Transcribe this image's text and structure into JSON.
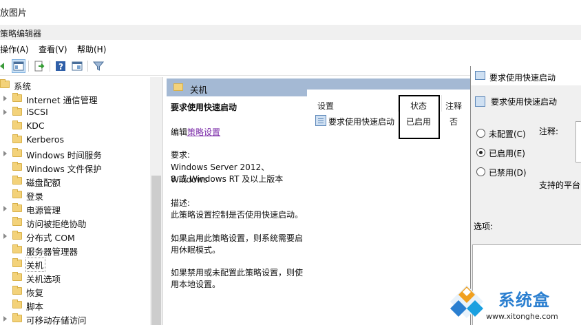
{
  "caption": "放图片",
  "window": {
    "title": "策略编辑器"
  },
  "menu": [
    {
      "label": "操作(A)"
    },
    {
      "label": "查看(V)"
    },
    {
      "label": "帮助(H)"
    }
  ],
  "toolbar": {
    "buttons": [
      "back-icon",
      "show-hide-tree-icon",
      "export-list-icon",
      "help-icon",
      "properties-view-icon",
      "filter-icon"
    ]
  },
  "tree": {
    "items": [
      {
        "label": "系统",
        "expandable": false
      },
      {
        "label": "Internet 通信管理",
        "expandable": true
      },
      {
        "label": "iSCSI",
        "expandable": true
      },
      {
        "label": "KDC",
        "expandable": false
      },
      {
        "label": "Kerberos",
        "expandable": false
      },
      {
        "label": "Windows 时间服务",
        "expandable": true
      },
      {
        "label": "Windows 文件保护",
        "expandable": false
      },
      {
        "label": "磁盘配额",
        "expandable": false
      },
      {
        "label": "登录",
        "expandable": false
      },
      {
        "label": "电源管理",
        "expandable": true
      },
      {
        "label": "访问被拒绝协助",
        "expandable": false
      },
      {
        "label": "分布式 COM",
        "expandable": true
      },
      {
        "label": "服务器管理器",
        "expandable": false
      },
      {
        "label": "关机",
        "expandable": false,
        "selected": true
      },
      {
        "label": "关机选项",
        "expandable": false
      },
      {
        "label": "恢复",
        "expandable": false
      },
      {
        "label": "脚本",
        "expandable": false
      },
      {
        "label": "可移动存储访问",
        "expandable": true
      }
    ]
  },
  "content": {
    "header_title": "关机",
    "description": {
      "title": "要求使用快速启动",
      "edit_prefix": "编辑",
      "edit_link": "策略设置",
      "requirements_label": "要求:",
      "requirements_line1": "Windows Server 2012、Windows",
      "requirements_line2": "8 或 Windows RT 及以上版本",
      "desc_label": "描述:",
      "desc_text": "此策略设置控制是否使用快速启动。",
      "enabled_line1": "如果启用此策略设置，则系统需要启",
      "enabled_line2": "用休眠模式。",
      "disabled_line1": "如果禁用或未配置此策略设置，则使",
      "disabled_line2": "用本地设置。"
    },
    "columns": {
      "setting": "设置",
      "state": "状态",
      "comment": "注释"
    },
    "row": {
      "setting": "要求使用快速启动",
      "state": "已启用",
      "comment": "否"
    }
  },
  "dialog": {
    "title": "要求使用快速启动",
    "policy_name": "要求使用快速启动",
    "options": [
      {
        "label": "未配置(C)",
        "checked": false
      },
      {
        "label": "已启用(E)",
        "checked": true
      },
      {
        "label": "已禁用(D)",
        "checked": false
      }
    ],
    "comment_label": "注释:",
    "platform_label": "支持的平台",
    "options_label": "选项:"
  },
  "watermark": {
    "brand": "系统盒",
    "url": "www.xitonghe.com"
  },
  "colors": {
    "header_bar": "#a4b9d4",
    "folder": "#f3d27a",
    "link": "#7b2ba8",
    "brand": "#2b7fd0"
  }
}
